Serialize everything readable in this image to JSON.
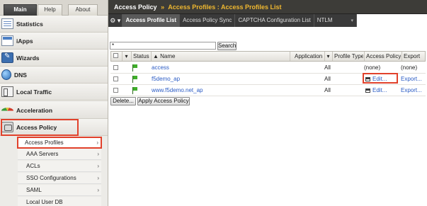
{
  "nav": {
    "tabs": [
      "Main",
      "Help",
      "About"
    ],
    "items": [
      {
        "label": "Statistics",
        "icon": "statistics-icon"
      },
      {
        "label": "iApps",
        "icon": "iapps-icon"
      },
      {
        "label": "Wizards",
        "icon": "wizards-icon"
      },
      {
        "label": "DNS",
        "icon": "dns-globe-icon"
      },
      {
        "label": "Local Traffic",
        "icon": "local-traffic-icon"
      },
      {
        "label": "Acceleration",
        "icon": "acceleration-gauge-icon"
      },
      {
        "label": "Access Policy",
        "icon": "access-policy-icon"
      }
    ],
    "submenu": [
      {
        "label": "Access Profiles",
        "chevron": "›"
      },
      {
        "label": "AAA Servers",
        "chevron": "›"
      },
      {
        "label": "ACLs",
        "chevron": "›"
      },
      {
        "label": "SSO Configurations",
        "chevron": "›"
      },
      {
        "label": "SAML",
        "chevron": "›"
      },
      {
        "label": "Local User DB",
        "chevron": ""
      }
    ]
  },
  "header": {
    "root": "Access Policy",
    "sep": "»",
    "current": "Access Profiles : Access Profiles List"
  },
  "tabs": {
    "gear": "⚙ ▾",
    "items": [
      "Access Profile List",
      "Access Policy Sync",
      "CAPTCHA Configuration List",
      "NTLM"
    ],
    "ntlm_dropdown": "▾"
  },
  "search": {
    "value": "*",
    "button": "Search"
  },
  "table": {
    "headers": [
      "",
      "▾",
      "Status",
      "▲ Name",
      "Application",
      "▾",
      "Profile Type",
      "Access Policy",
      "Export"
    ],
    "rows": [
      {
        "name": "access",
        "application": "",
        "profile_type": "All",
        "access_policy": "(none)",
        "export": "(none)"
      },
      {
        "name": "f5demo_ap",
        "application": "",
        "profile_type": "All",
        "access_policy": "Edit...",
        "export": "Export..."
      },
      {
        "name": "www.f5demo.net_ap",
        "application": "",
        "profile_type": "All",
        "access_policy": "Edit...",
        "export": "Export..."
      }
    ]
  },
  "actions": {
    "delete": "Delete...",
    "apply": "Apply Access Policy"
  },
  "colors": {
    "highlight": "#e1412b",
    "link": "#2a5bc4",
    "crumb_accent": "#f0b830"
  }
}
